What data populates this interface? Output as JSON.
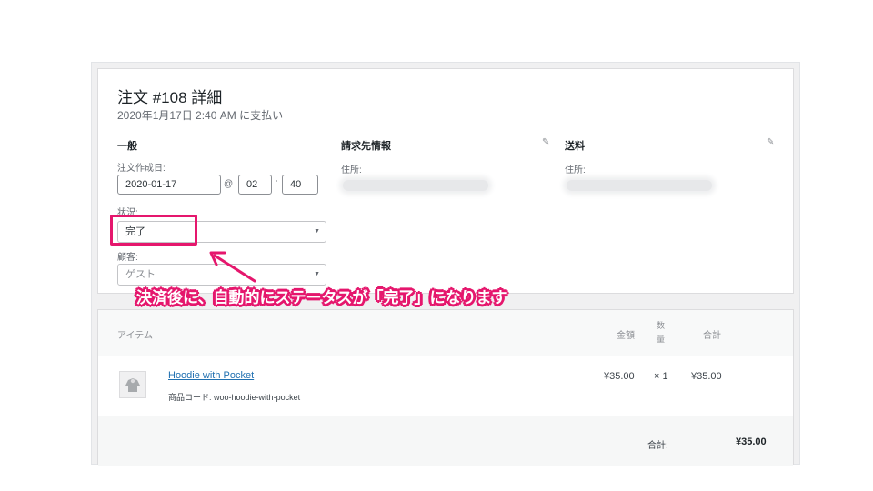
{
  "order": {
    "title": "注文 #108 詳細",
    "subtitle": "2020年1月17日 2:40 AM に支払い"
  },
  "general": {
    "heading": "一般",
    "date_label": "注文作成日:",
    "date_value": "2020-01-17",
    "at_sign": "@",
    "hour_value": "02",
    "time_sep": ":",
    "minute_value": "40",
    "status_label": "状況:",
    "status_value": "完了",
    "customer_label": "顧客:",
    "customer_value": "ゲスト"
  },
  "billing": {
    "heading": "請求先情報",
    "address_label": "住所:"
  },
  "shipping": {
    "heading": "送料",
    "address_label": "住所:"
  },
  "annotation": {
    "text": "決済後に、自動的にステータスが「完了」になります",
    "color": "#e5176d"
  },
  "items": {
    "headers": {
      "item": "アイテム",
      "price": "金額",
      "qty_line1": "数",
      "qty_line2": "量",
      "total": "合計"
    },
    "rows": [
      {
        "name": "Hoodie with Pocket",
        "sku_label": "商品コード:",
        "sku_value": "woo-hoodie-with-pocket",
        "price": "¥35.00",
        "qty": "× 1",
        "total": "¥35.00"
      }
    ],
    "footer_label": "合計:",
    "footer_total": "¥35.00"
  },
  "colors": {
    "link": "#2271b1",
    "annotation": "#e5176d"
  }
}
